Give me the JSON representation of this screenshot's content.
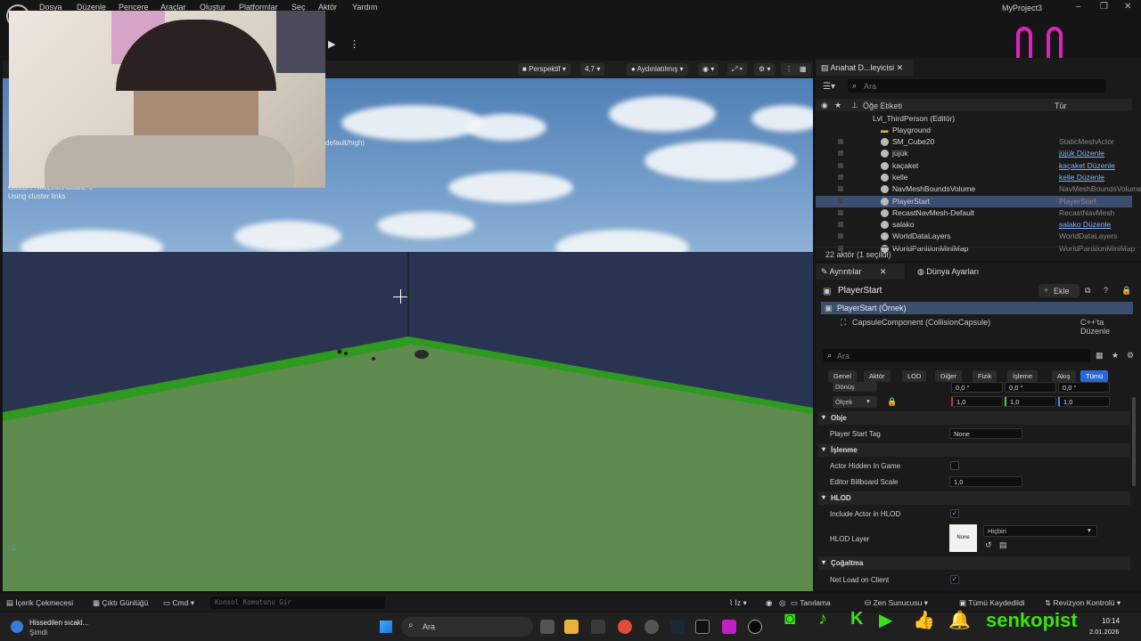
{
  "menu": [
    "Dosya",
    "Düzenle",
    "Pencere",
    "Araçlar",
    "Oluştur",
    "Platformlar",
    "Seç",
    "Aktör",
    "Yardım"
  ],
  "project_name": "MyProject3",
  "viewport": {
    "perspective": "Perspektif",
    "fov": "4,7",
    "lighting": "Aydınlatılmış",
    "stats": [
      "default/high)",
      "Custom NavLinks Count: 0",
      "Using cluster links"
    ]
  },
  "outliner": {
    "tab": "Anahat D...leyicisi",
    "search_placeholder": "Ara",
    "col_label": "Öğe Etiketi",
    "col_type": "Tür",
    "level": "Lvl_ThirdPerson (Editör)",
    "folder": "Playground",
    "rows": [
      {
        "label": "SM_Cube20",
        "type": "StaticMeshActor",
        "link": false
      },
      {
        "label": "jüjük",
        "type": "jüjük Düzenle",
        "link": true
      },
      {
        "label": "kaçaket",
        "type": "kaçaket Düzenle",
        "link": true
      },
      {
        "label": "kelle",
        "type": "kelle Düzenle",
        "link": true
      },
      {
        "label": "NavMeshBoundsVolume",
        "type": "NavMeshBoundsVolume",
        "link": false
      },
      {
        "label": "PlayerStart",
        "type": "PlayerStart",
        "link": false,
        "selected": true
      },
      {
        "label": "RecastNavMesh-Default",
        "type": "RecastNavMesh",
        "link": false
      },
      {
        "label": "salako",
        "type": "salako Düzenle",
        "link": true
      },
      {
        "label": "WorldDataLayers",
        "type": "WorldDataLayers",
        "link": false
      },
      {
        "label": "WorldPartitionMiniMap",
        "type": "WorldPartitionMiniMap",
        "link": false
      }
    ],
    "status": "22 aktör (1 seçildi)"
  },
  "details": {
    "tab1": "Ayrıntılar",
    "tab2": "Dünya Ayarları",
    "actor": "PlayerStart",
    "add_label": "Ekle",
    "instance": "PlayerStart (Örnek)",
    "component": "CapsuleComponent (CollisionCapsule)",
    "cpp_edit": "C++'ta Düzenle",
    "search_placeholder": "Ara",
    "filters": [
      "Genel",
      "Aktör",
      "LOD",
      "Diğer",
      "Fizik",
      "İşleme",
      "Akış",
      "Tümü"
    ],
    "rotation_label": "Dönüş",
    "rotation": [
      "0,0 °",
      "0,0 °",
      "0,0 °"
    ],
    "scale_label": "Ölçek",
    "scale": [
      "1,0",
      "1,0",
      "1,0"
    ],
    "sec_obje": "Obje",
    "player_start_tag_label": "Player Start Tag",
    "player_start_tag": "None",
    "sec_isleme": "İşlenme",
    "actor_hidden_label": "Actor Hidden In Game",
    "billboard_label": "Editor Billboard Scale",
    "billboard_value": "1,0",
    "sec_hlod": "HLOD",
    "include_hlod_label": "Include Actor in HLOD",
    "hlod_layer_label": "HLOD Layer",
    "hlod_layer_none": "None",
    "hlod_layer_value": "Hiçbiri",
    "sec_cog": "Çoğaltma",
    "net_load_label": "Net Load on Client"
  },
  "bottombar": {
    "content_drawer": "İçerik Çekmecesi",
    "output_log": "Çıktı Günlüğü",
    "cmd": "Cmd",
    "console_placeholder": "Konsol Komutunu Gir",
    "trace": "İz",
    "derive": "Tanılama",
    "zen": "Zen Sunucusu",
    "saved": "Tümü Kaydedildi",
    "revision": "Revizyon Kontrolü"
  },
  "taskbar": {
    "weather_title": "Hissedilen sıcakl...",
    "weather_sub": "Şimdi",
    "search": "Ara",
    "time": "10:14",
    "date": "2.01.2026"
  },
  "overlay_name": "senkopist"
}
